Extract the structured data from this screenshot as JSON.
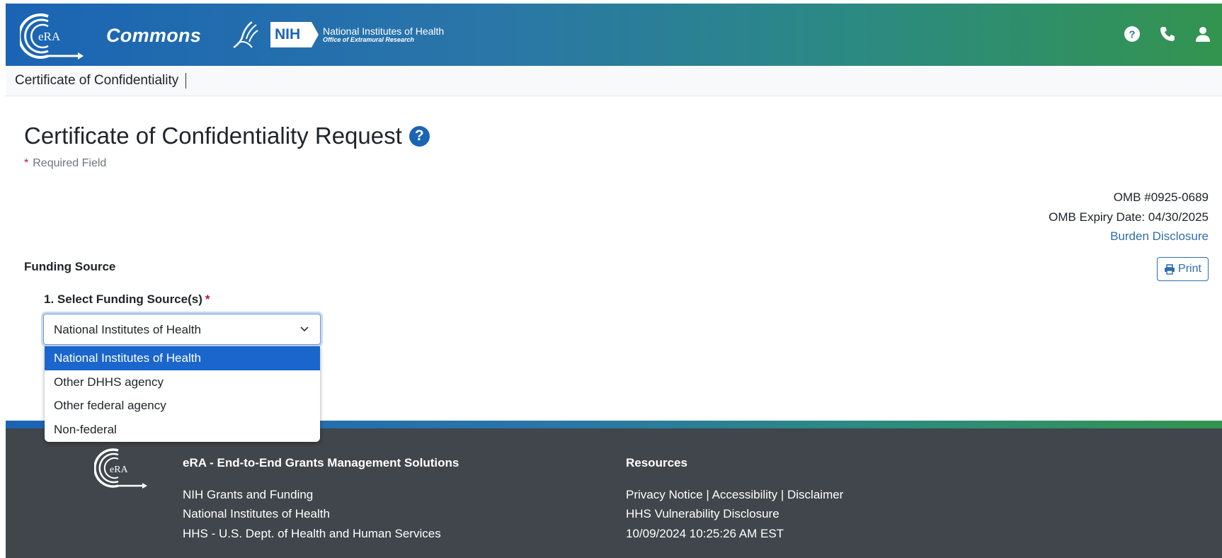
{
  "header": {
    "logo_text": "eRA",
    "app_name": "Commons",
    "nih_badge": "NIH",
    "nih_title": "National Institutes of Health",
    "nih_subtitle": "Office of Extramural Research",
    "icons": [
      "question-circle-icon",
      "phone-icon",
      "user-icon"
    ]
  },
  "subnav": {
    "title": "Certificate of Confidentiality"
  },
  "page": {
    "title": "Certificate of Confidentiality Request",
    "required_star": "*",
    "required_text": "Required Field",
    "omb_number": "OMB #0925-0689",
    "omb_expiry": "OMB Expiry Date: 04/30/2025",
    "burden_link": "Burden Disclosure",
    "print_label": "Print"
  },
  "funding": {
    "section_label": "Funding Source",
    "field_label": "1. Select Funding Source(s)",
    "required_star": "*",
    "selected_value": "National Institutes of Health",
    "options": [
      "National Institutes of Health",
      "Other DHHS agency",
      "Other federal agency",
      "Non-federal"
    ]
  },
  "footer": {
    "logo_text": "eRA",
    "col1_heading": "eRA - End-to-End Grants Management Solutions",
    "col1_links": [
      "NIH Grants and Funding",
      "National Institutes of Health",
      "HHS - U.S. Dept. of Health and Human Services"
    ],
    "col2_heading": "Resources",
    "col2_lines": [
      "Privacy Notice | Accessibility | Disclaimer",
      "HHS Vulnerability Disclosure",
      "10/09/2024 10:25:26 AM EST"
    ]
  },
  "colors": {
    "header_start": "#1b64b4",
    "header_end": "#33944f",
    "link": "#2f6dab",
    "required": "#c8102e",
    "selected_option": "#1a66cc",
    "footer_bg": "#40464b"
  }
}
